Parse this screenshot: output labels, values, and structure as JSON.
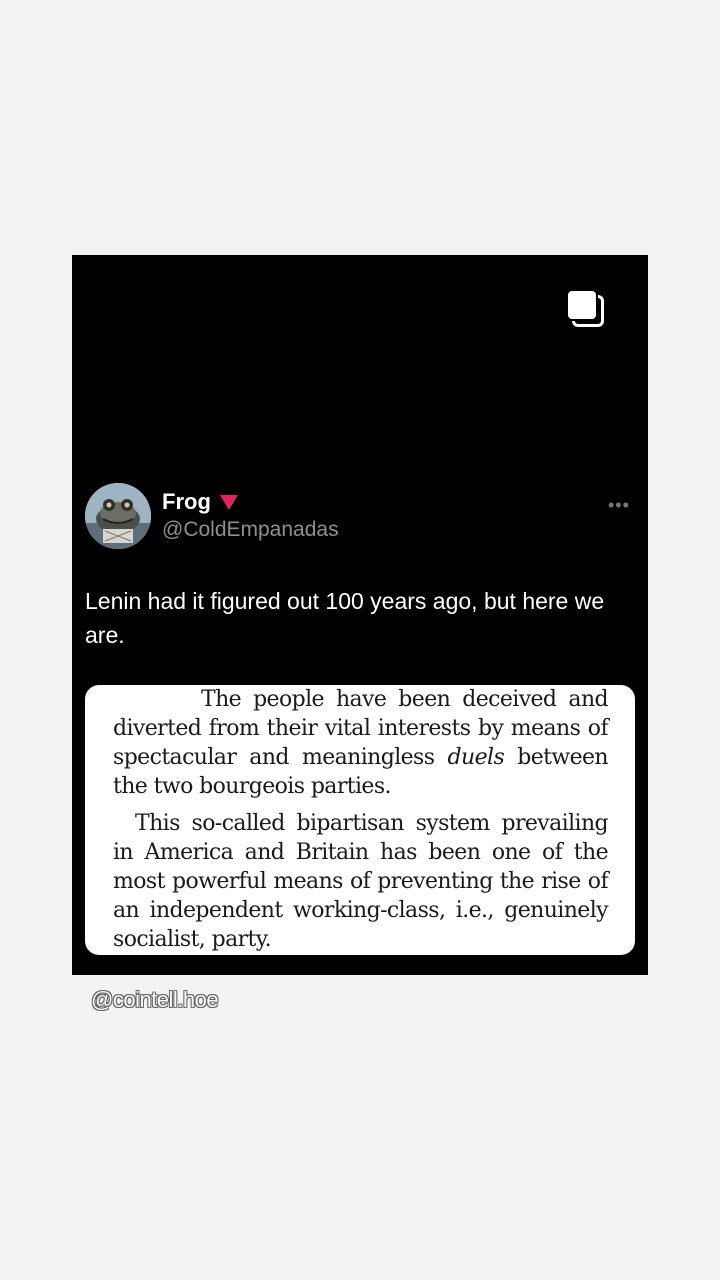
{
  "tweet": {
    "display_name": "Frog",
    "handle": "@ColdEmpanadas",
    "more_label": "•••",
    "text": "Lenin had it figured out 100 years ago, but here we are.",
    "flag_color": "#e0245e"
  },
  "quote": {
    "p1_a": "The people have been deceived and diverted from their vital interests by means of spectacular and meaningless ",
    "p1_em": "duels",
    "p1_b": " between the two bourgeois parties.",
    "p2": "This so-called bipartisan system prevailing in America and Britain has been one of the most powerful means of preventing the rise of an independent working-class, i.e., genuinely socialist, party."
  },
  "watermark": "@cointell.hoe",
  "icons": {
    "multi_image": "multiple-images-icon",
    "flag": "red-triangle-icon",
    "avatar": "frog-avatar"
  }
}
